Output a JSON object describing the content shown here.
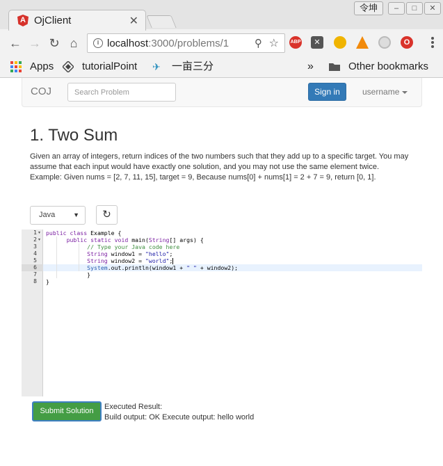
{
  "browser": {
    "tab_title": "OjClient",
    "favicon_letter": "A",
    "user_chip": "令坤",
    "url_host": "localhost",
    "url_path": ":3000/problems/1",
    "bookmarks": [
      {
        "label": "Apps"
      },
      {
        "label": "tutorialPoint"
      },
      {
        "label": "一亩三分"
      },
      {
        "label": "Other bookmarks"
      }
    ],
    "overflow_label": "»",
    "extensions": [
      "ABP"
    ]
  },
  "navbar": {
    "brand": "COJ",
    "search_placeholder": "Search Problem",
    "signin_label": "Sign in",
    "user_label": "username"
  },
  "problem": {
    "title": "1. Two Sum",
    "description": "Given an array of integers, return indices of the two numbers such that they add up to a specific target. You may assume that each input would have exactly one solution, and you may not use the same element twice. Example: Given nums = [2, 7, 11, 15], target = 9, Because nums[0] + nums[1] = 2 + 7 = 9, return [0, 1]."
  },
  "editor": {
    "language": "Java",
    "line_numbers": [
      "1",
      "2",
      "3",
      "4",
      "5",
      "6",
      "7",
      "8"
    ],
    "active_line": 6
  },
  "result": {
    "submit_label": "Submit Solution",
    "label": "Executed Result:",
    "text": "Build output: OK Execute output: hello world"
  }
}
